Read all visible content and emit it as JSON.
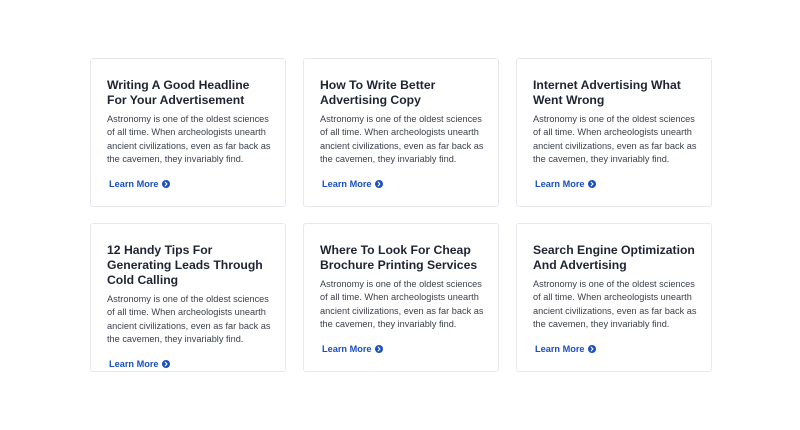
{
  "cards": [
    {
      "title": "Writing A Good Headline For Your Advertisement",
      "text": "Astronomy is one of the oldest sciences of all time. When archeologists unearth ancient civilizations, even as far back as the cavemen, they invariably find.",
      "link_label": "Learn More"
    },
    {
      "title": "How To Write Better Advertising Copy",
      "text": "Astronomy is one of the oldest sciences of all time. When archeologists unearth ancient civilizations, even as far back as the cavemen, they invariably find.",
      "link_label": "Learn More"
    },
    {
      "title": "Internet Advertising What Went Wrong",
      "text": "Astronomy is one of the oldest sciences of all time. When archeologists unearth ancient civilizations, even as far back as the cavemen, they invariably find.",
      "link_label": "Learn More"
    },
    {
      "title": "12 Handy Tips For Generating Leads Through Cold Calling",
      "text": "Astronomy is one of the oldest sciences of all time. When archeologists unearth ancient civilizations, even as far back as the cavemen, they invariably find.",
      "link_label": "Learn More"
    },
    {
      "title": "Where To Look For Cheap Brochure Printing Services",
      "text": "Astronomy is one of the oldest sciences of all time. When archeologists unearth ancient civilizations, even as far back as the cavemen, they invariably find.",
      "link_label": "Learn More"
    },
    {
      "title": "Search Engine Optimization And Advertising",
      "text": "Astronomy is one of the oldest sciences of all time. When archeologists unearth ancient civilizations, even as far back as the cavemen, they invariably find.",
      "link_label": "Learn More"
    }
  ],
  "icons": {
    "link_arrow": "chevron-right-circle-icon"
  },
  "colors": {
    "accent": "#1a4fc4",
    "title": "#1f2433",
    "text": "#3b3f4a",
    "border": "#e6e8ee"
  }
}
